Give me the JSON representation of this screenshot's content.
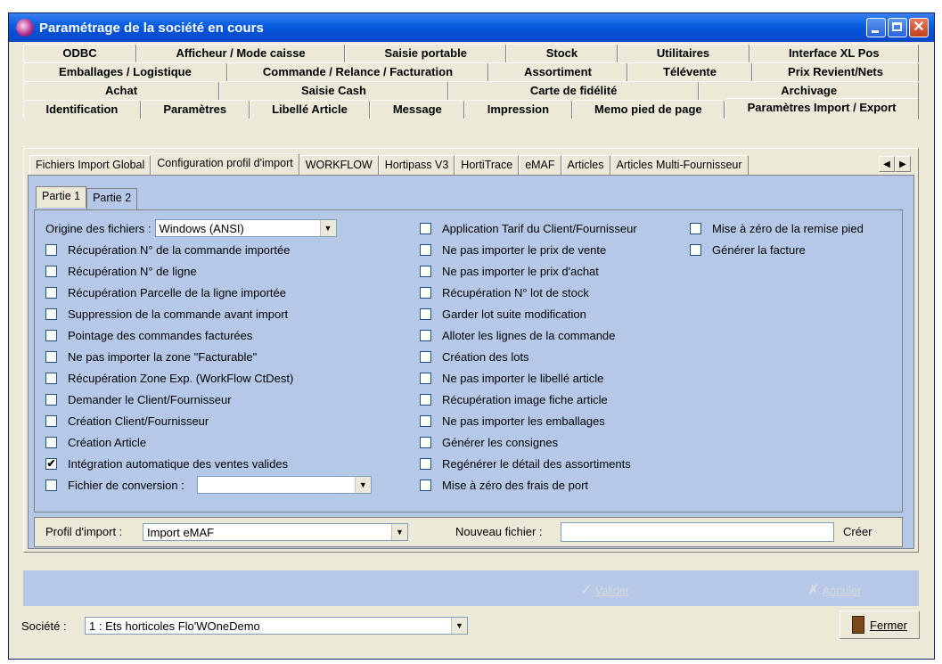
{
  "window": {
    "title": "Paramétrage de la société en cours"
  },
  "tab_rows": [
    [
      "ODBC",
      "Afficheur / Mode caisse",
      "Saisie portable",
      "Stock",
      "Utilitaires",
      "Interface XL Pos"
    ],
    [
      "Emballages / Logistique",
      "Commande / Relance / Facturation",
      "Assortiment",
      "Télévente",
      "Prix Revient/Nets"
    ],
    [
      "Achat",
      "Saisie Cash",
      "Carte de fidélité",
      "Archivage"
    ],
    [
      "Identification",
      "Paramètres",
      "Libellé Article",
      "Message",
      "Impression",
      "Memo pied de page",
      "Paramètres Import / Export"
    ]
  ],
  "active_main_tab": "Paramètres Import / Export",
  "sub_tabs": [
    "Fichiers Import Global",
    "Configuration profil d'import",
    "WORKFLOW",
    "Hortipass V3",
    "HortiTrace",
    "eMAF",
    "Articles",
    "Articles Multi-Fournisseur"
  ],
  "active_sub_tab": "Configuration profil d'import",
  "part_tabs": [
    "Partie 1",
    "Partie 2"
  ],
  "origine": {
    "label": "Origine des fichiers :",
    "value": "Windows (ANSI)"
  },
  "col1": [
    {
      "label": "Récupération N° de la commande importée",
      "checked": false
    },
    {
      "label": "Récupération N° de ligne",
      "checked": false
    },
    {
      "label": "Récupération Parcelle de la ligne importée",
      "checked": false
    },
    {
      "label": "Suppression de la commande avant import",
      "checked": false
    },
    {
      "label": "Pointage des commandes facturées",
      "checked": false
    },
    {
      "label": "Ne pas importer la zone \"Facturable\"",
      "checked": false
    },
    {
      "label": "Récupération Zone Exp. (WorkFlow CtDest)",
      "checked": false
    },
    {
      "label": "Demander le Client/Fournisseur",
      "checked": false
    },
    {
      "label": "Création Client/Fournisseur",
      "checked": false
    },
    {
      "label": "Création Article",
      "checked": false
    },
    {
      "label": "Intégration automatique des ventes valides",
      "checked": true
    }
  ],
  "conversion": {
    "label": "Fichier de conversion :",
    "checked": false,
    "value": ""
  },
  "col2": [
    {
      "label": "Application Tarif du Client/Fournisseur",
      "checked": false
    },
    {
      "label": "Ne pas importer le prix de vente",
      "checked": false
    },
    {
      "label": "Ne pas importer le prix d'achat",
      "checked": false
    },
    {
      "label": "Récupération N° lot de stock",
      "checked": false
    },
    {
      "label": "Garder lot suite modification",
      "checked": false
    },
    {
      "label": "Alloter les lignes de la commande",
      "checked": false
    },
    {
      "label": "Création des lots",
      "checked": false
    },
    {
      "label": "Ne pas importer le libellé article",
      "checked": false
    },
    {
      "label": "Récupération image fiche article",
      "checked": false
    },
    {
      "label": "Ne pas importer les emballages",
      "checked": false
    },
    {
      "label": "Générer les consignes",
      "checked": false
    },
    {
      "label": "Regénérer le détail des assortiments",
      "checked": false
    },
    {
      "label": "Mise à zéro des frais de port",
      "checked": false
    }
  ],
  "col3": [
    {
      "label": "Mise à zéro de la remise pied",
      "checked": false
    },
    {
      "label": "Générer la facture",
      "checked": false
    }
  ],
  "profile": {
    "label": "Profil d'import :",
    "value": "Import eMAF",
    "new_file_label": "Nouveau fichier :",
    "new_file_value": "",
    "create_label": "Créer"
  },
  "actions": {
    "validate": "Valider",
    "cancel": "Annuler"
  },
  "footer": {
    "company_label": "Société :",
    "company_value": "1 : Ets horticoles Flo'WOneDemo",
    "close_label": "Fermer"
  },
  "check_glyph": "✔",
  "dropdown_glyph": "▼"
}
